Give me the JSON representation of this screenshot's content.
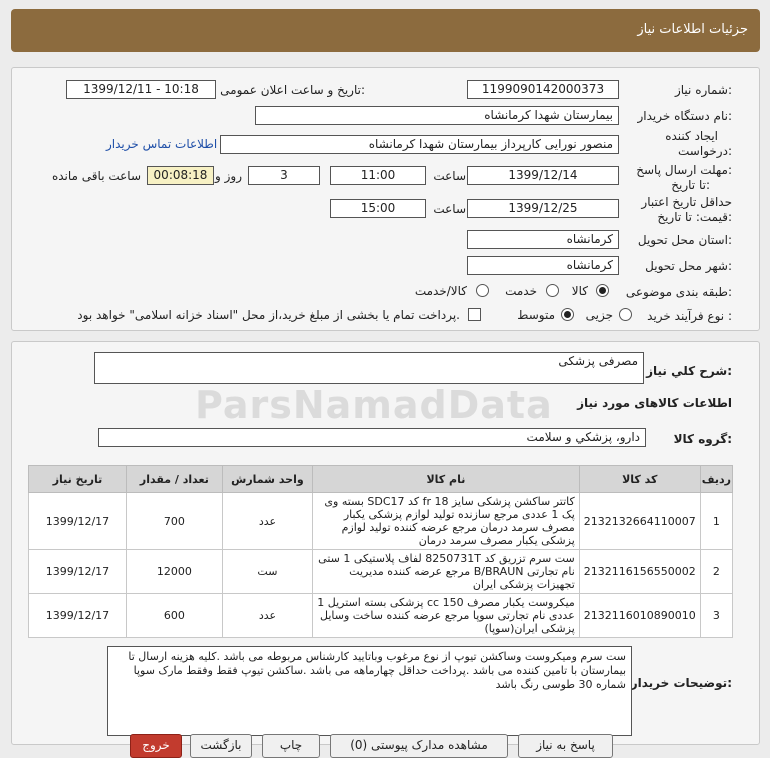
{
  "header": {
    "title": "جزئیات اطلاعات نیاز"
  },
  "form": {
    "need_number": {
      "label": "شماره نیاز:",
      "value": "1199090142000373"
    },
    "announce": {
      "label": "تاریخ و ساعت اعلان عمومی:",
      "value": "1399/12/11 - 10:18"
    },
    "buyer_org": {
      "label": "نام دستگاه خریدار:",
      "value": "بیمارستان شهدا کرمانشاه"
    },
    "creator": {
      "label_1": "ایجاد کننده",
      "label_2": "درخواست:",
      "value": "منصور نورایی کارپرداز بیمارستان شهدا کرمانشاه",
      "contact_link": "اطلاعات تماس خریدار"
    },
    "reply_deadline": {
      "label_1": "مهلت ارسال پاسخ:",
      "label_2": "تا تاریخ:",
      "date": "1399/12/14",
      "time_label": "ساعت",
      "time": "11:00",
      "days": "3",
      "days_label": "روز و",
      "remaining": "00:08:18",
      "remaining_label": "ساعت باقی مانده"
    },
    "validity": {
      "label_1": "حداقل تاریخ اعتبار",
      "label_2": "قیمت: تا تاریخ:",
      "date": "1399/12/25",
      "time_label": "ساعت",
      "time": "15:00"
    },
    "province": {
      "label": "استان محل تحویل:",
      "value": "کرمانشاه"
    },
    "city": {
      "label": "شهر محل تحویل:",
      "value": "کرمانشاه"
    },
    "category": {
      "label": "طبقه بندی موضوعی:",
      "options": [
        "کالا",
        "خدمت",
        "کالا/خدمت"
      ],
      "selected": "کالا"
    },
    "purchase_type": {
      "label": "نوع فرآیند خرید :",
      "options": [
        "جزیی",
        "متوسط"
      ],
      "selected": "متوسط",
      "treasury_note": "پرداخت تمام یا بخشی از مبلغ خرید،از محل \"اسناد خزانه اسلامی\" خواهد بود."
    }
  },
  "summary": {
    "label": "شرح کلي نياز:",
    "value": "مصرفی پزشکی",
    "goods_info_title": "اطلاعات کالاهای مورد نیاز",
    "group_label": "گروه کالا:",
    "group_value": "دارو، پزشکي و سلامت",
    "watermark": "ParsNamadData"
  },
  "table": {
    "headers": [
      "ردیف",
      "کد کالا",
      "نام کالا",
      "واحد شمارش",
      "تعداد / مقدار",
      "تاریخ نیاز"
    ],
    "rows": [
      {
        "row": "1",
        "code": "2132132664110007",
        "name": "کاتتر ساکشن پزشکی سایز fr 18 کد SDC17 بسته وی پک 1 عددی مرجع سازنده تولید لوازم پزشکی یکبار مصرف سرمد درمان مرجع عرضه کننده تولید لوازم پزشکی یکبار مصرف سرمد درمان",
        "unit": "عدد",
        "qty": "700",
        "date": "1399/12/17"
      },
      {
        "row": "2",
        "code": "2132116156550002",
        "name": "ست سرم تزریق کد 8250731T لفاف پلاستیکی 1 ستی نام تجارتی B/BRAUN مرجع عرضه کننده مدیریت تجهیزات پزشکی ایران",
        "unit": "ست",
        "qty": "12000",
        "date": "1399/12/17"
      },
      {
        "row": "3",
        "code": "2132116010890010",
        "name": "میکروست یکبار مصرف cc 150 پزشکی بسته استریل 1 عددی نام تجارتی سوپا مرجع عرضه کننده ساخت وسایل پزشکی ایران(سوپا)",
        "unit": "عدد",
        "qty": "600",
        "date": "1399/12/17"
      }
    ]
  },
  "notes": {
    "label": "توضیحات خریدار:",
    "text": "ست سرم ومیکروست وساکشن تیوپ از نوع مرغوب وباتایید کارشناس مربوطه می باشد .کلیه هزینه ارسال تا بیمارستان با تامین کننده می باشد .پرداخت حداقل چهارماهه می باشد .ساکشن تیوپ فقط وفقط مارک سوپا شماره 30 طوسی رنگ باشد"
  },
  "buttons": {
    "reply": "پاسخ به نیاز",
    "view_docs": "مشاهده مدارک پیوستی (0)",
    "print": "چاپ",
    "back": "بازگشت",
    "exit": "خروج"
  }
}
